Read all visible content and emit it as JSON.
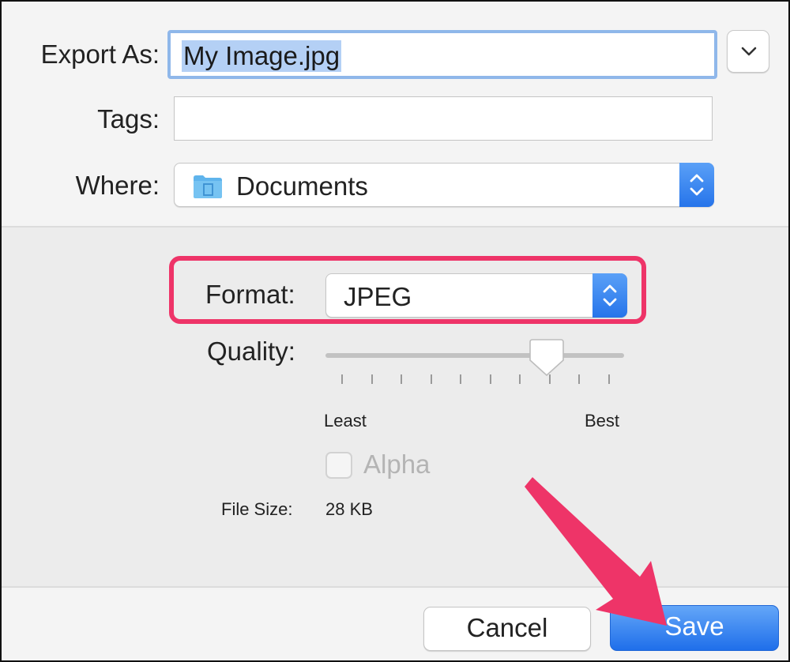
{
  "export_as": {
    "label": "Export As:",
    "value": "My Image.jpg"
  },
  "tags": {
    "label": "Tags:",
    "value": ""
  },
  "where": {
    "label": "Where:",
    "value": "Documents",
    "icon": "folder-icon"
  },
  "format": {
    "label": "Format:",
    "value": "JPEG"
  },
  "quality": {
    "label": "Quality:",
    "min_label": "Least",
    "max_label": "Best",
    "level": 0.77,
    "tick_count": 10
  },
  "alpha": {
    "label": "Alpha",
    "checked": false,
    "enabled": false
  },
  "file_size": {
    "label": "File Size:",
    "value": "28 KB"
  },
  "buttons": {
    "cancel": "Cancel",
    "save": "Save"
  },
  "colors": {
    "accent_blue": "#2674ea",
    "highlight_pink": "#ee3468",
    "selection": "#b4d0f5"
  }
}
